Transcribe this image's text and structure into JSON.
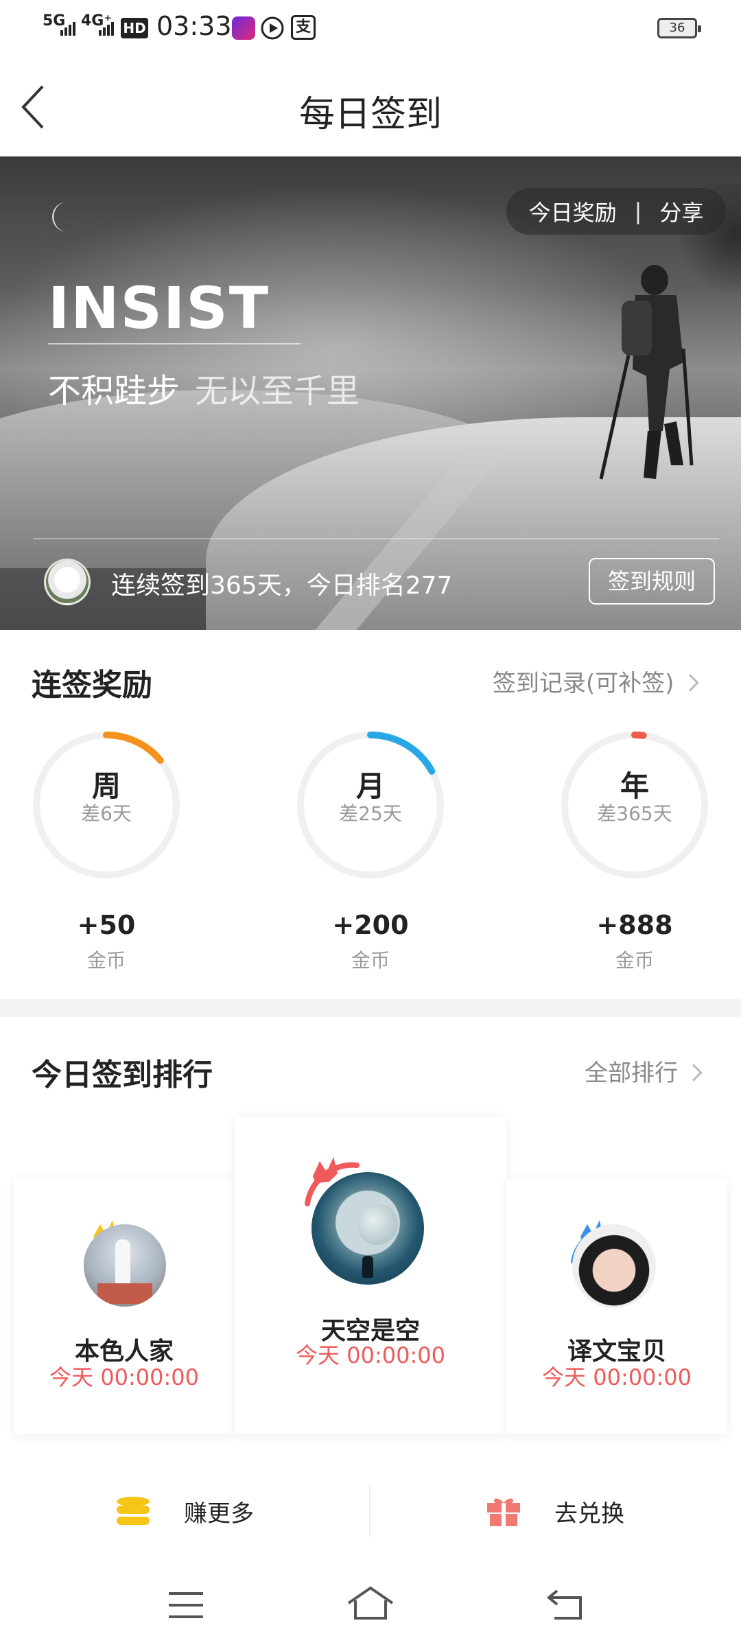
{
  "status_bar": {
    "signal_1": "5G",
    "signal_2": "4G⁺",
    "hd_badge": "HD",
    "time": "03:33",
    "battery": "36"
  },
  "nav": {
    "title": "每日签到",
    "back_icon": "chevron-left-icon"
  },
  "banner": {
    "reward_label": "今日奖励",
    "share_label": "分享",
    "separator": "|",
    "headline": "INSIST",
    "motto_main": "不积跬步",
    "motto_sub": "无以至千里",
    "streak_text": "连续签到365天，今日排名277",
    "rules_button": "签到规则"
  },
  "streak_rewards": {
    "title": "连签奖励",
    "link": "签到记录(可补签)",
    "items": [
      {
        "label": "周",
        "remaining": "差6天",
        "reward": "+50",
        "unit": "金币",
        "progress": 0.14,
        "color": "#f5921e"
      },
      {
        "label": "月",
        "remaining": "差25天",
        "reward": "+200",
        "unit": "金币",
        "progress": 0.17,
        "color": "#29a8e6"
      },
      {
        "label": "年",
        "remaining": "差365天",
        "reward": "+888",
        "unit": "金币",
        "progress": 0.02,
        "color": "#ef5b4a"
      }
    ]
  },
  "ranking": {
    "title": "今日签到排行",
    "link": "全部排行",
    "entries": [
      {
        "rank": 2,
        "name": "本色人家",
        "time": "今天 00:00:00",
        "crown_color": "#f5c518"
      },
      {
        "rank": 1,
        "name": "天空是空",
        "time": "今天 00:00:00",
        "crown_color": "#ef5b5b"
      },
      {
        "rank": 3,
        "name": "译文宝贝",
        "time": "今天 00:00:00",
        "crown_color": "#3a8fe6"
      }
    ]
  },
  "actions": {
    "earn_more": "赚更多",
    "redeem": "去兑换"
  },
  "colors": {
    "accent_red": "#ef5b5b",
    "gold": "#f5c518"
  }
}
